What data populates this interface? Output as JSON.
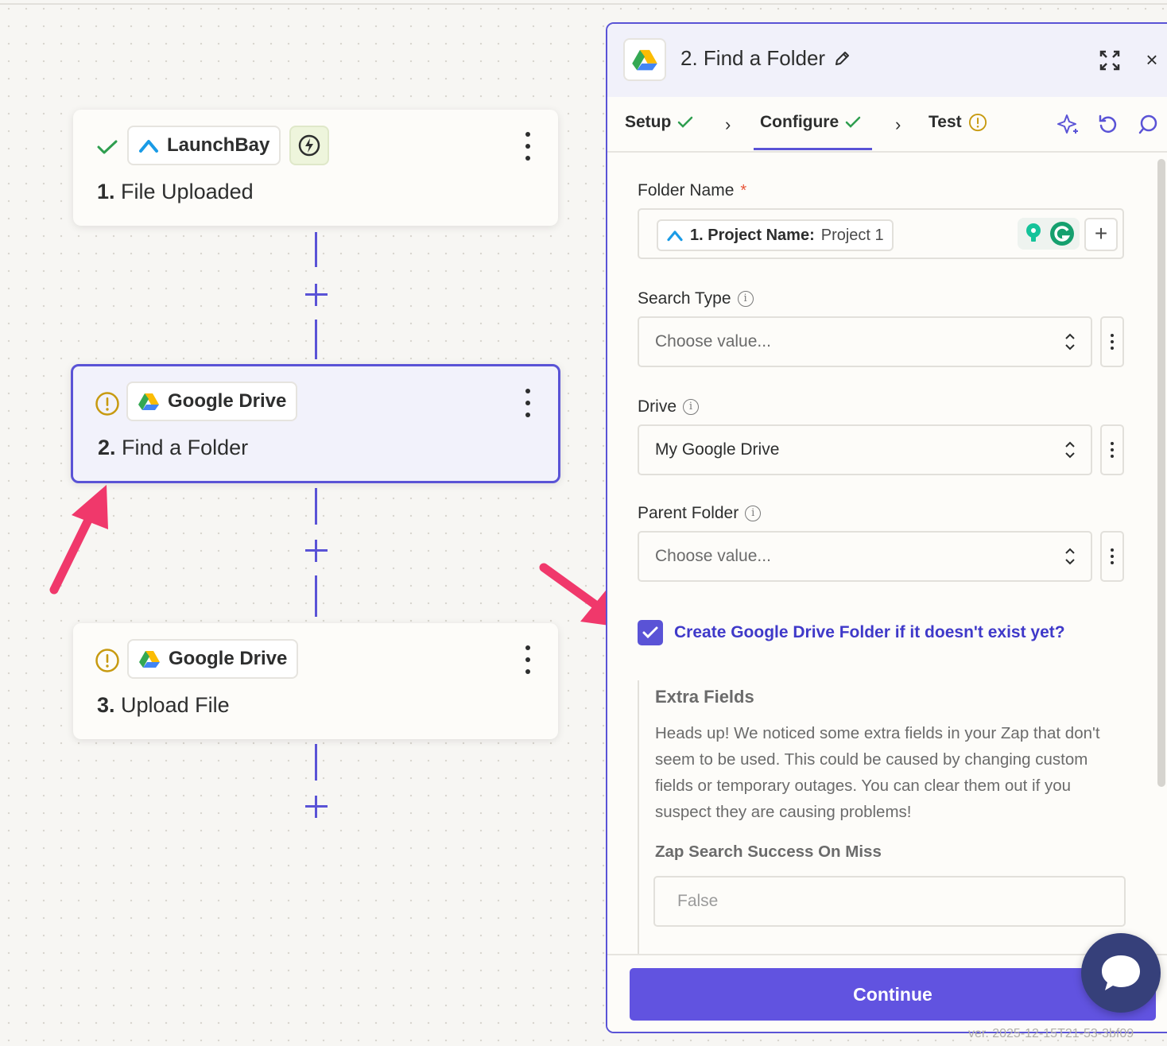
{
  "canvas": {
    "steps": [
      {
        "app": "LaunchBay",
        "number": "1.",
        "title": "File Uploaded",
        "status": "complete"
      },
      {
        "app": "Google Drive",
        "number": "2.",
        "title": "Find a Folder",
        "status": "warning"
      },
      {
        "app": "Google Drive",
        "number": "3.",
        "title": "Upload File",
        "status": "warning"
      }
    ]
  },
  "panel": {
    "title": "2. Find a Folder",
    "tabs": [
      {
        "label": "Setup",
        "state": "complete"
      },
      {
        "label": "Configure",
        "state": "complete"
      },
      {
        "label": "Test",
        "state": "warning"
      }
    ],
    "fields": {
      "folder_name": {
        "label": "Folder Name",
        "required_mark": "*",
        "mapped_key": "1. Project Name:",
        "mapped_value": "Project 1"
      },
      "search_type": {
        "label": "Search Type",
        "value": "Choose value..."
      },
      "drive": {
        "label": "Drive",
        "value": "My Google Drive"
      },
      "parent_folder": {
        "label": "Parent Folder",
        "value": "Choose value..."
      }
    },
    "checkbox": {
      "label": "Create Google Drive Folder if it doesn't exist yet?",
      "checked": true
    },
    "extra_fields": {
      "title": "Extra Fields",
      "note": "Heads up! We noticed some extra fields in your Zap that don't seem to be used. This could be caused by changing custom fields or temporary outages. You can clear them out if you suspect they are causing problems!",
      "field_label": "Zap Search Success On Miss",
      "field_value": "False"
    },
    "continue_label": "Continue",
    "version": "ver. 2025-12-15T21-53-3bf09"
  },
  "colors": {
    "accent": "#5a53d6",
    "continue": "#6153e0",
    "annotation_arrow": "#f0386b",
    "success": "#2e9e4f",
    "warning": "#c79a10"
  }
}
